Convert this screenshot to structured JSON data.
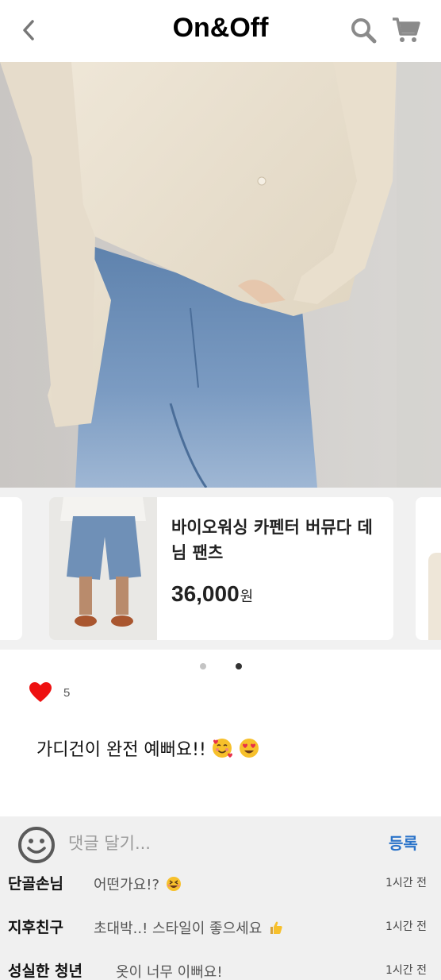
{
  "header": {
    "title": "On&Off",
    "back_icon": "chevron-left-icon",
    "search_icon": "search-icon",
    "cart_icon": "cart-icon"
  },
  "product": {
    "name": "바이오워싱 카펜터 버뮤다 데님 팬츠",
    "price": "36,000",
    "currency": "원"
  },
  "carousel": {
    "total_dots": 2,
    "active_index": 1
  },
  "post": {
    "like_count": "5",
    "caption": "가디건이 완전 예뻐요!!",
    "caption_emojis": [
      "smiling-face-with-hearts-emoji",
      "heart-eyes-emoji"
    ]
  },
  "comment_box": {
    "placeholder": "댓글 달기...",
    "submit_label": "등록"
  },
  "comments": [
    {
      "author": "단골손님",
      "text": "어떤가요!?",
      "emoji": "grinning-squinting-emoji",
      "time": "1시간 전"
    },
    {
      "author": "지후친구",
      "text": "초대박..! 스타일이 좋으세요",
      "emoji": "thumbs-up-emoji",
      "time": "1시간 전"
    },
    {
      "author": "성실한 청년",
      "text": "옷이 너무 이뻐요!",
      "emoji": "",
      "time": "1시간 전"
    }
  ],
  "colors": {
    "accent_link": "#2a73c9",
    "heart": "#ee1111",
    "comment_bg": "#f0f0f0",
    "carousel_bg": "#f1f1f1"
  }
}
